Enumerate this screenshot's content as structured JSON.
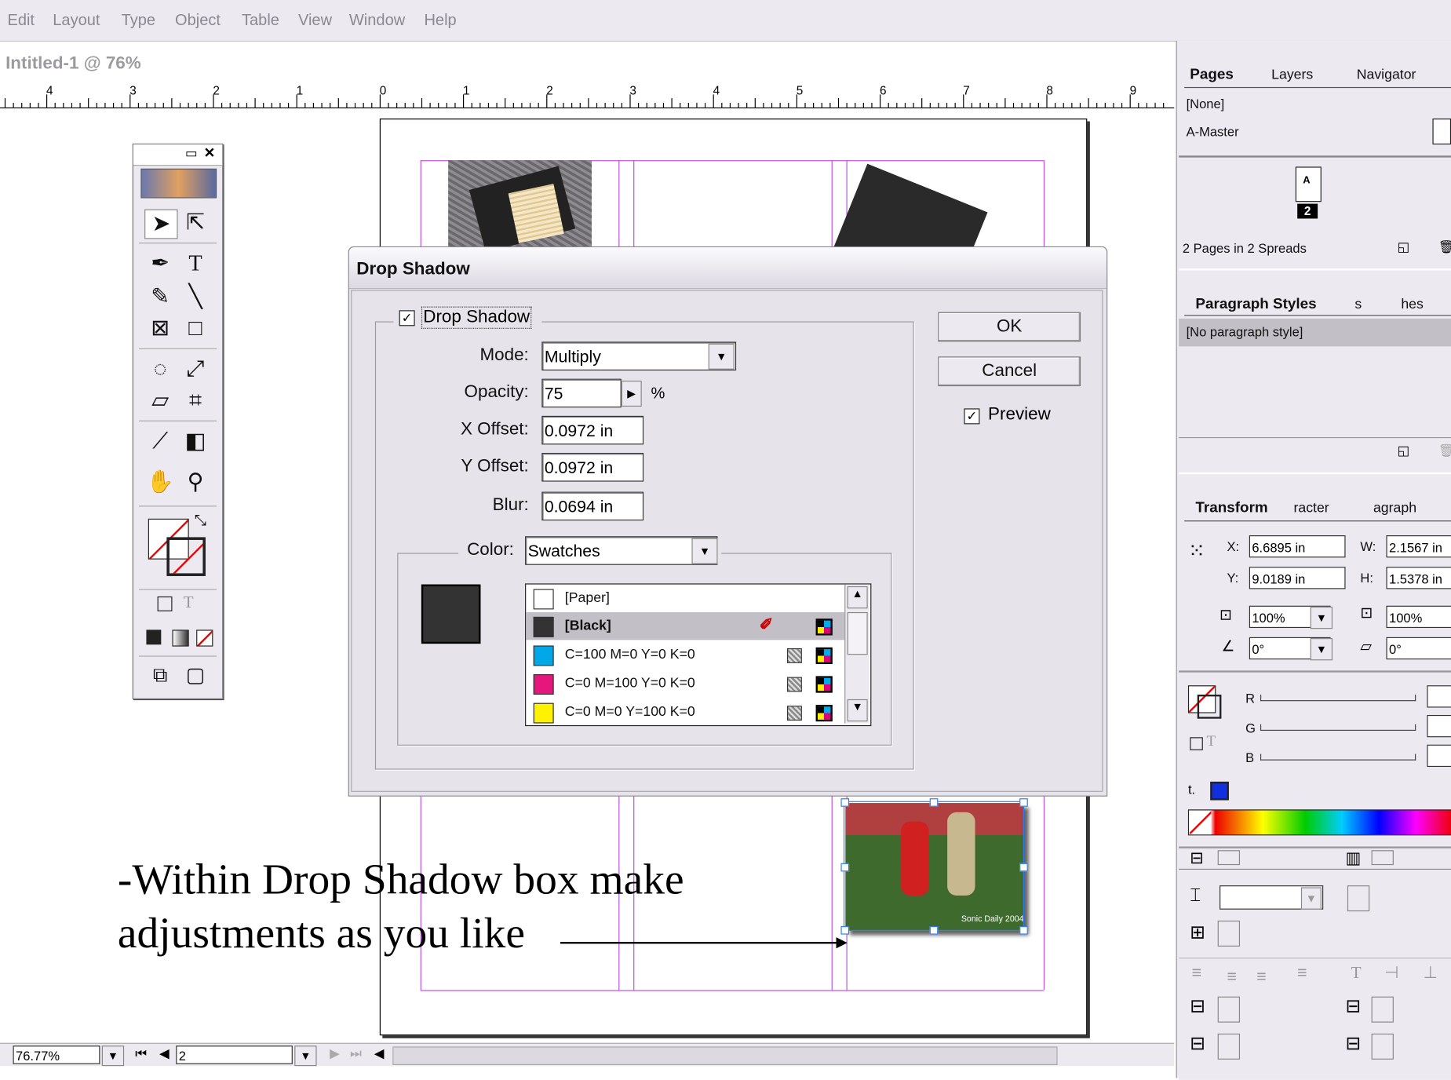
{
  "menu": [
    "Edit",
    "Layout",
    "Type",
    "Object",
    "Table",
    "View",
    "Window",
    "Help"
  ],
  "document_title": "Intitled-1 @ 76%",
  "ruler_numbers": [
    "4",
    "3",
    "2",
    "1",
    "0",
    "1",
    "2",
    "3",
    "4",
    "5",
    "6",
    "7",
    "8",
    "9"
  ],
  "dialog": {
    "title": "Drop Shadow",
    "enable_label": "Drop Shadow",
    "mode_label": "Mode:",
    "mode_value": "Multiply",
    "opacity_label": "Opacity:",
    "opacity_value": "75",
    "opacity_unit": "%",
    "x_offset_label": "X Offset:",
    "x_offset_value": "0.0972 in",
    "y_offset_label": "Y Offset:",
    "y_offset_value": "0.0972 in",
    "blur_label": "Blur:",
    "blur_value": "0.0694 in",
    "color_label": "Color:",
    "color_value": "Swatches",
    "ok_label": "OK",
    "cancel_label": "Cancel",
    "preview_label": "Preview",
    "swatches": [
      {
        "name": "[Paper]",
        "color": "#ffffff"
      },
      {
        "name": "[Black]",
        "color": "#333333"
      },
      {
        "name": "C=100 M=0 Y=0 K=0",
        "color": "#00a8e8"
      },
      {
        "name": "C=0 M=100 Y=0 K=0",
        "color": "#e5177d"
      },
      {
        "name": "C=0 M=0 Y=100 K=0",
        "color": "#fff200"
      }
    ]
  },
  "pages_panel": {
    "tabs": [
      "Pages",
      "Layers",
      "Navigator"
    ],
    "none_label": "[None]",
    "master_label": "A-Master",
    "page_letter": "A",
    "page_number": "2",
    "summary": "2 Pages in 2 Spreads"
  },
  "paragraph_panel": {
    "tabs": [
      "Paragraph Styles",
      "s",
      "hes"
    ],
    "item": "[No paragraph style]"
  },
  "transform_panel": {
    "tabs": [
      "Transform",
      "racter",
      "agraph"
    ],
    "x_label": "X:",
    "x_value": "6.6895 in",
    "y_label": "Y:",
    "y_value": "9.0189 in",
    "w_label": "W:",
    "w_value": "2.1567 in",
    "h_label": "H:",
    "h_value": "1.5378 in",
    "scale_x": "100%",
    "scale_y": "100%",
    "rotate": "0°",
    "shear": "0°"
  },
  "color_panel": {
    "r_label": "R",
    "g_label": "G",
    "b_label": "B"
  },
  "status": {
    "zoom": "76.77%",
    "page": "2"
  },
  "caption": {
    "line1": "-Within Drop Shadow box make",
    "line2": "adjustments as you like"
  },
  "photo_credit": "Sonic Daily 2004"
}
